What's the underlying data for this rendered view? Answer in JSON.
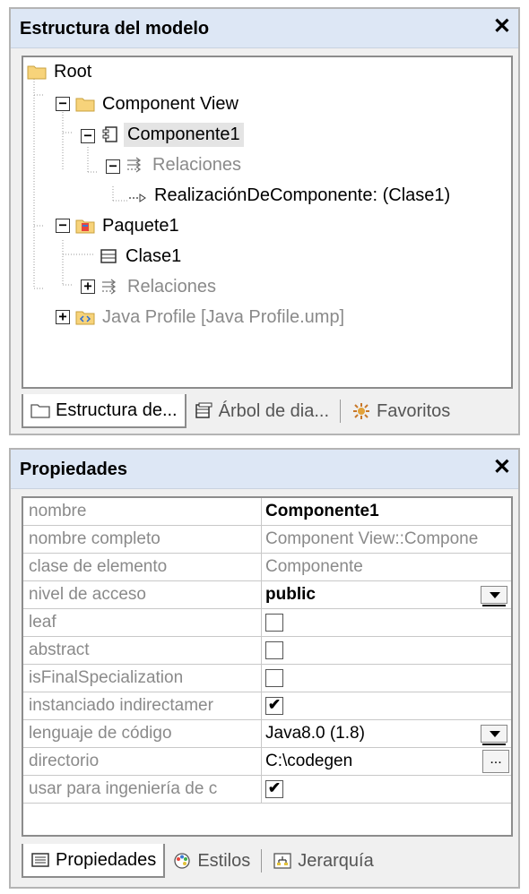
{
  "tree_panel": {
    "title": "Estructura del modelo",
    "close": "✕",
    "nodes": [
      {
        "label": "Root"
      },
      {
        "label": "Component View"
      },
      {
        "label": "Componente1"
      },
      {
        "label": "Relaciones"
      },
      {
        "label": "RealizaciónDeComponente:  (Clase1)"
      },
      {
        "label": "Paquete1"
      },
      {
        "label": "Clase1"
      },
      {
        "label": "Relaciones"
      },
      {
        "label": "Java Profile [Java Profile.ump]"
      }
    ],
    "expanders": [
      "−",
      "−",
      "−",
      "−",
      "+",
      "+"
    ],
    "tabs": [
      "Estructura de...",
      "Árbol de dia...",
      "Favoritos"
    ]
  },
  "props_panel": {
    "title": "Propiedades",
    "close": "✕",
    "rows": [
      {
        "name": "nombre",
        "value": "Componente1"
      },
      {
        "name": "nombre completo",
        "value": "Component View::Compone"
      },
      {
        "name": "clase de elemento",
        "value": "Componente"
      },
      {
        "name": "nivel de acceso",
        "value": "public"
      },
      {
        "name": "leaf",
        "value": ""
      },
      {
        "name": "abstract",
        "value": ""
      },
      {
        "name": "isFinalSpecialization",
        "value": ""
      },
      {
        "name": "instanciado indirectamer",
        "value": "✔"
      },
      {
        "name": "lenguaje de código",
        "value": "Java8.0 (1.8)"
      },
      {
        "name": "directorio",
        "value": "C:\\codegen"
      },
      {
        "name": "usar para ingeniería de c",
        "value": "✔"
      }
    ],
    "ellipsis": "...",
    "tabs": [
      "Propiedades",
      "Estilos",
      "Jerarquía"
    ]
  },
  "colors": {
    "titlebar": "#dde7f5",
    "folder": "#f7d37a",
    "selection": "#e4e4e4",
    "muted_text": "#8a8a8a"
  },
  "icons": [
    "folder-icon",
    "component-icon",
    "relations-icon",
    "realization-arrow-icon",
    "package-icon",
    "class-icon",
    "profile-icon",
    "tree-tab-icon",
    "diagram-tree-icon",
    "favorites-icon",
    "properties-tab-icon",
    "styles-icon",
    "hierarchy-icon"
  ]
}
